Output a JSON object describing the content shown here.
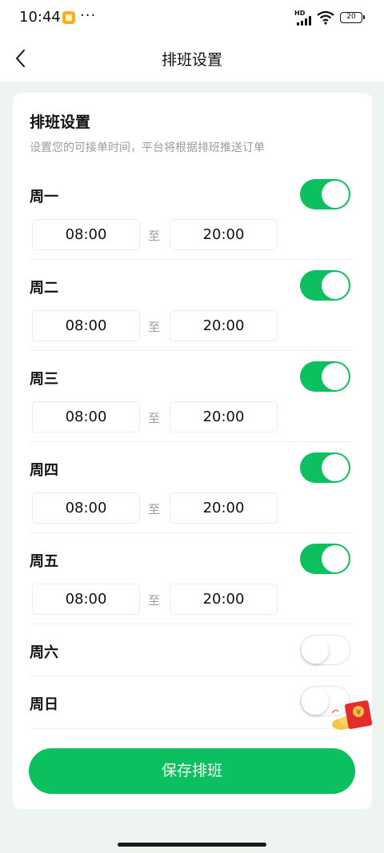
{
  "status_bar": {
    "time": "10:44",
    "more": "···",
    "network_label": "HD",
    "battery_level": "20"
  },
  "nav": {
    "title": "排班设置"
  },
  "card": {
    "title": "排班设置",
    "subtitle": "设置您的可接单时间，平台将根据排班推送订单"
  },
  "schedule": {
    "to_label": "至",
    "days": [
      {
        "name": "周一",
        "enabled": true,
        "start": "08:00",
        "end": "20:00"
      },
      {
        "name": "周二",
        "enabled": true,
        "start": "08:00",
        "end": "20:00"
      },
      {
        "name": "周三",
        "enabled": true,
        "start": "08:00",
        "end": "20:00"
      },
      {
        "name": "周四",
        "enabled": true,
        "start": "08:00",
        "end": "20:00"
      },
      {
        "name": "周五",
        "enabled": true,
        "start": "08:00",
        "end": "20:00"
      },
      {
        "name": "周六",
        "enabled": false
      },
      {
        "name": "周日",
        "enabled": false
      }
    ]
  },
  "save_button": "保存排班",
  "red_packet": {
    "symbol": "¥"
  },
  "colors": {
    "accent": "#0cc05f",
    "background": "#eef5f1",
    "muted_text": "#9b9b9b"
  }
}
